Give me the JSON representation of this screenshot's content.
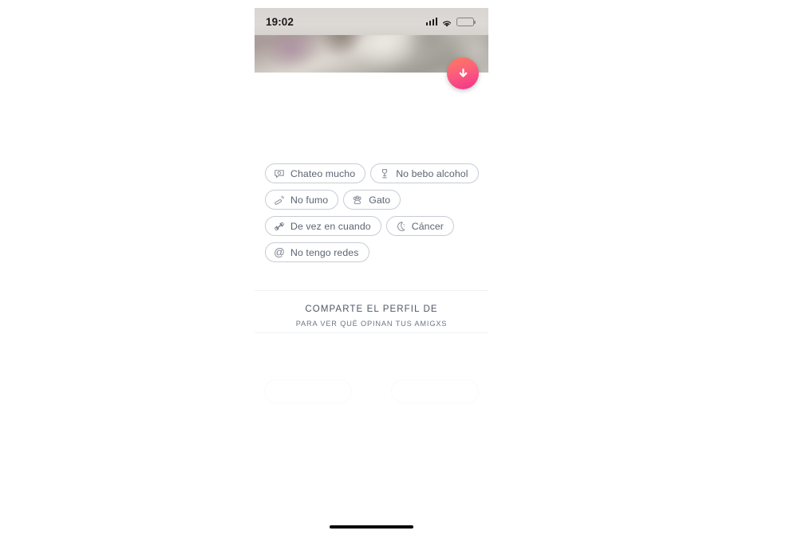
{
  "statusbar": {
    "time": "19:02",
    "signal_icon": "cellular-signal-icon",
    "wifi_icon": "wifi-icon",
    "battery_icon": "battery-icon"
  },
  "photo": {
    "name": "profile-photo",
    "alt": "blurred close-up photo of fur / hair"
  },
  "scroll_button": {
    "name": "scroll-down-button",
    "icon": "arrow-down-icon",
    "gradient_from": "#fd7b5c",
    "gradient_to": "#f3318e"
  },
  "tags": [
    {
      "label": "Chateo mucho",
      "icon": "chat-bubble-icon"
    },
    {
      "label": "No bebo alcohol",
      "icon": "cocktail-glass-icon"
    },
    {
      "label": "No fumo",
      "icon": "cigarette-icon"
    },
    {
      "label": "Gato",
      "icon": "paw-print-icon"
    },
    {
      "label": "De vez en cuando",
      "icon": "dumbbell-icon"
    },
    {
      "label": "Cáncer",
      "icon": "moon-icon"
    },
    {
      "label": "No tengo redes",
      "icon": "at-sign-icon"
    }
  ],
  "share": {
    "title": "COMPARTE EL PERFIL DE",
    "subtitle": "PARA VER QUÉ OPINAN TUS AMIGXS"
  },
  "home_indicator": {
    "name": "home-indicator"
  },
  "theme": {
    "tag_border": "#c8ccd4",
    "tag_text": "#5c6472",
    "share_title_color": "#4e5664",
    "divider": "#f1f2f4",
    "background": "#ffffff"
  }
}
